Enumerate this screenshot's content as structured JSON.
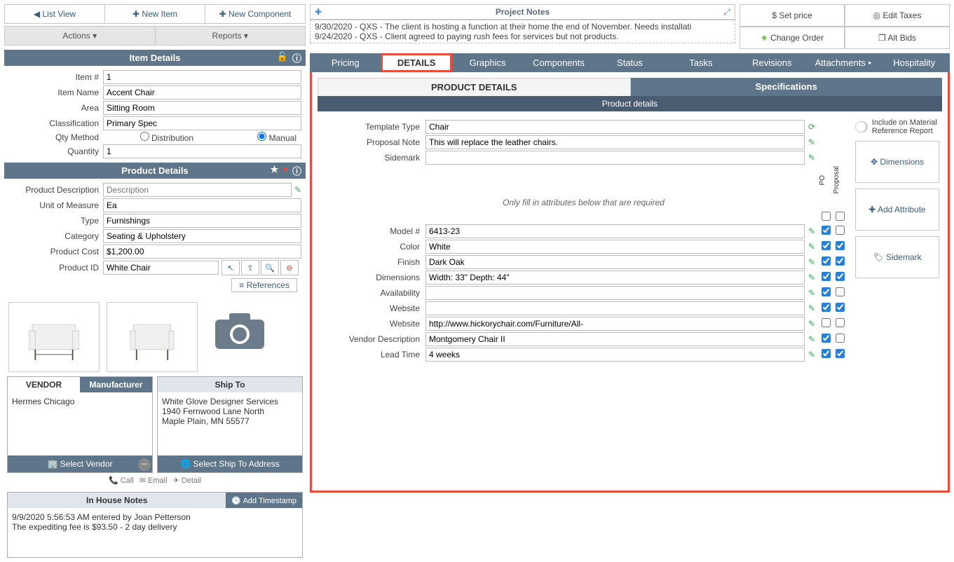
{
  "topbar": {
    "list_view": "List View",
    "new_item": "New Item",
    "new_component": "New Component"
  },
  "menus": {
    "actions": "Actions",
    "reports": "Reports"
  },
  "item_details": {
    "title": "Item Details",
    "item_num_label": "Item #",
    "item_num": "1",
    "item_name_label": "Item Name",
    "item_name": "Accent Chair",
    "area_label": "Area",
    "area": "Sitting Room",
    "classification_label": "Classification",
    "classification": "Primary Spec",
    "qty_method_label": "Qty Method",
    "distribution": "Distribution",
    "manual": "Manual",
    "quantity_label": "Quantity",
    "quantity": "1"
  },
  "product_details": {
    "title": "Product Details",
    "desc_label": "Product Description",
    "desc_placeholder": "Description",
    "uom_label": "Unit of Measure",
    "uom": "Ea",
    "type_label": "Type",
    "type": "Furnishings",
    "category_label": "Category",
    "category": "Seating & Upholstery",
    "cost_label": "Product Cost",
    "cost": "$1,200.00",
    "pid_label": "Product ID",
    "pid": "White Chair",
    "references": "References"
  },
  "vendor": {
    "tab_vendor": "VENDOR",
    "tab_manufacturer": "Manufacturer",
    "name": "Hermes Chicago",
    "select": "Select Vendor"
  },
  "shipto": {
    "title": "Ship To",
    "line1": "White Glove Designer Services",
    "line2": "1940 Fernwood Lane North",
    "line3": "Maple Plain, MN 55577",
    "select": "Select Ship To Address"
  },
  "contacts": {
    "call": "Call",
    "email": "Email",
    "detail": "Detail"
  },
  "notes": {
    "title": "In House Notes",
    "add_ts": "Add Timestamp",
    "line1": "9/9/2020 5:56:53 AM entered by Joan Petterson",
    "line2": "The expediting fee is $93.50 - 2 day delivery"
  },
  "project_notes": {
    "title": "Project Notes",
    "lines": [
      "9/30/2020 - QXS - The client is hosting a function at their home the end of November. Needs installati",
      "9/24/2020 - QXS - Client agreed to paying rush fees for services but not products."
    ]
  },
  "right_actions": {
    "set_price": "Set price",
    "edit_taxes": "Edit Taxes",
    "change_order": "Change Order",
    "alt_bids": "Alt Bids"
  },
  "tabs": [
    "Pricing",
    "DETAILS",
    "Graphics",
    "Components",
    "Status",
    "Tasks",
    "Revisions",
    "Attachments •",
    "Hospitality"
  ],
  "subtabs": {
    "pd": "PRODUCT DETAILS",
    "spec": "Specifications",
    "bar": "Product details"
  },
  "detail_form": {
    "template_type_label": "Template Type",
    "template_type": "Chair",
    "proposal_note_label": "Proposal Note",
    "proposal_note": "This will replace the leather chairs.",
    "sidemark_label": "Sidemark",
    "sidemark": "",
    "hint": "Only fill in attributes below that are required",
    "col_po": "PO",
    "col_proposal": "Proposal",
    "rows": [
      {
        "label": "Model #",
        "value": "6413-23",
        "po": true,
        "prop": false
      },
      {
        "label": "Color",
        "value": "White",
        "po": true,
        "prop": true
      },
      {
        "label": "Finish",
        "value": "Dark Oak",
        "po": true,
        "prop": true
      },
      {
        "label": "Dimensions",
        "value": "Width: 33\" Depth: 44\"",
        "po": true,
        "prop": true
      },
      {
        "label": "Availability",
        "value": "",
        "po": true,
        "prop": false
      },
      {
        "label": "Website",
        "value": "",
        "po": true,
        "prop": true
      },
      {
        "label": "Website",
        "value": "http://www.hickorychair.com/Furniture/All-",
        "po": false,
        "prop": false,
        "link": true
      },
      {
        "label": "Vendor Description",
        "value": "Montgomery Chair II",
        "po": true,
        "prop": false
      },
      {
        "label": "Lead Time",
        "value": "4 weeks",
        "po": true,
        "prop": true
      }
    ]
  },
  "side_actions": {
    "toggle": "Include on Material Reference Report",
    "dimensions": "Dimensions",
    "add_attr": "Add Attribute",
    "sidemark": "Sidemark"
  }
}
